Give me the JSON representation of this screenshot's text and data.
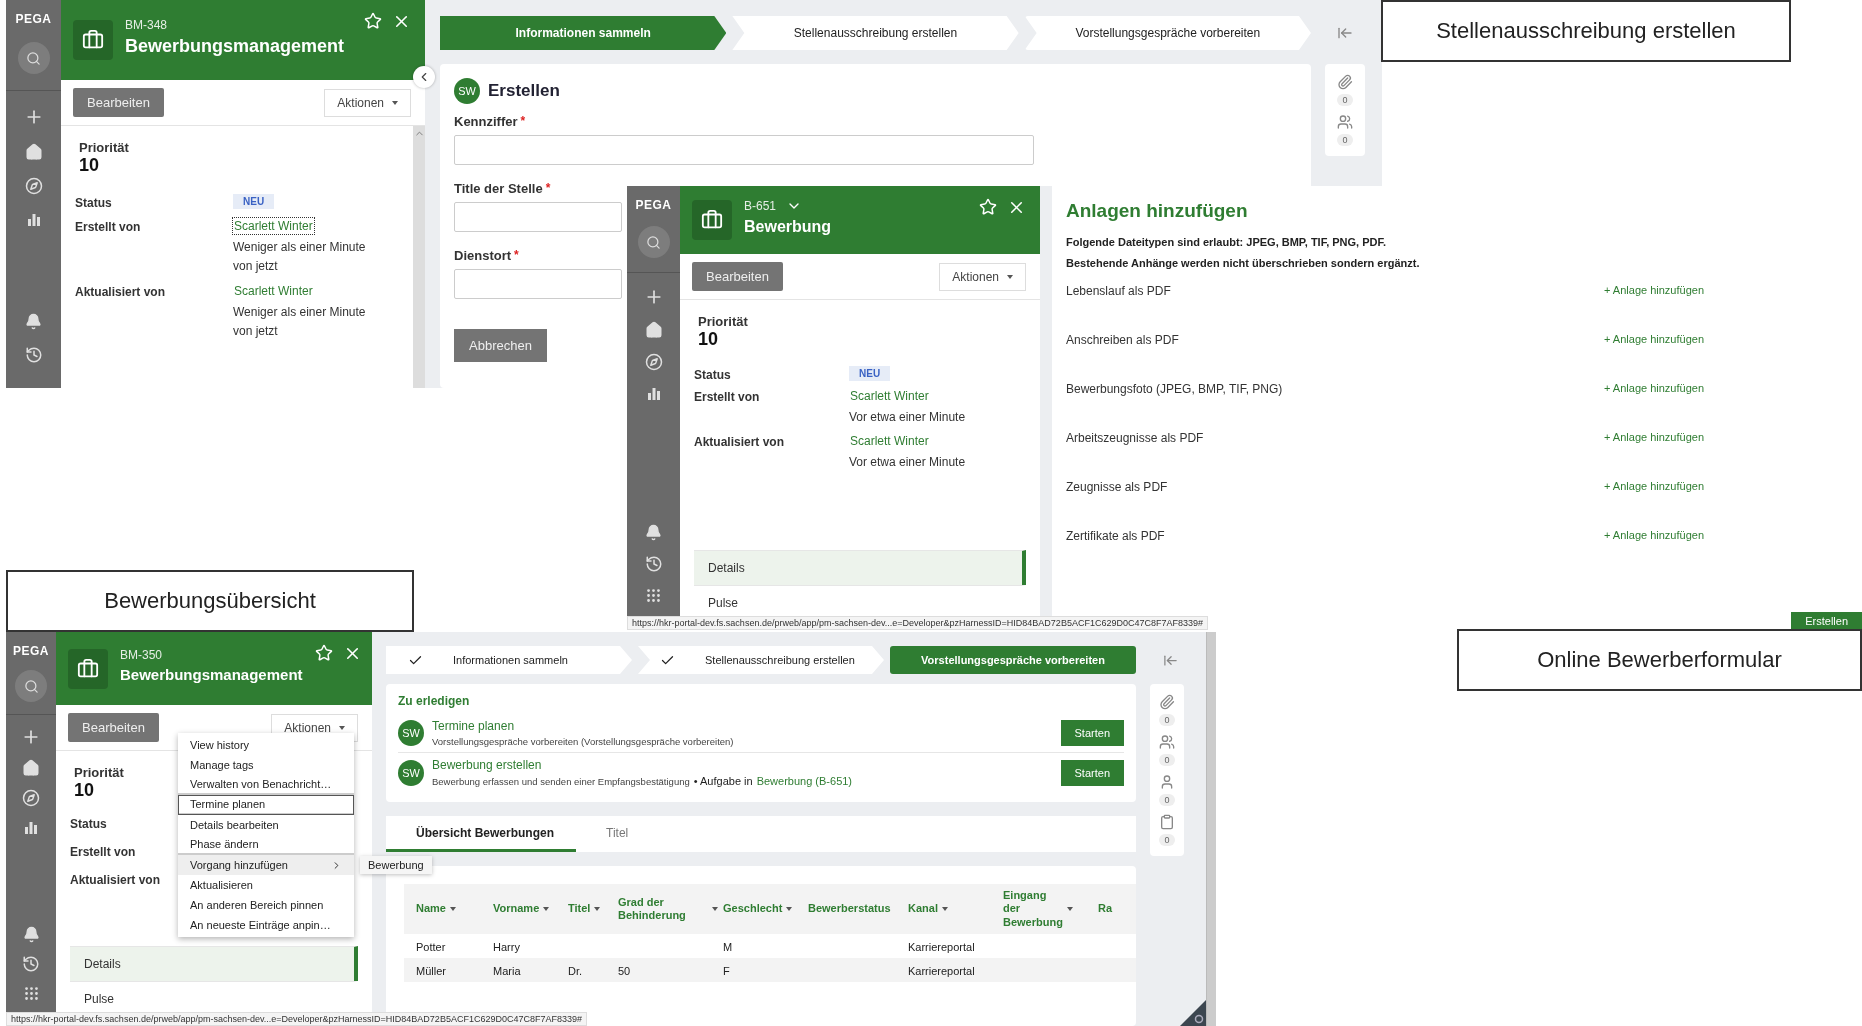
{
  "captions": [
    {
      "text": "Stellenausschreibung erstellen"
    },
    {
      "text": "Bewerbungsübersicht"
    },
    {
      "text": "Online Bewerberformular"
    }
  ],
  "screens": [
    {
      "kind": "form",
      "case": {
        "brand": "PEGA",
        "id": "BM-348",
        "id_menu": false,
        "title": "Bewerbungsmanagement",
        "edit": "Bearbeiten",
        "actions": "Aktionen",
        "priority_label": "Priorität",
        "priority": "10",
        "apps_button": false,
        "fields": [
          {
            "label": "Status",
            "badge": "NEU"
          },
          {
            "label": "Erstellt von",
            "person": "Scarlett Winter",
            "focused": true,
            "time": "Weniger als einer Minute von jetzt"
          },
          {
            "label": "Aktualisiert von",
            "person": "Scarlett Winter",
            "focused": false,
            "time": "Weniger als einer Minute von jetzt"
          }
        ]
      },
      "stages": [
        {
          "label": "Informationen sammeln",
          "selected": true,
          "done": false
        },
        {
          "label": "Stellenausschreibung erstellen",
          "selected": false,
          "done": false
        },
        {
          "label": "Vorstellungsgespräche vorbereiten",
          "selected": false,
          "done": false
        }
      ],
      "form": {
        "avatar": "SW",
        "title": "Erstellen",
        "required_mark": "*",
        "fields": [
          {
            "label": "Kennziffer",
            "required": true
          },
          {
            "label": "Title der Stelle",
            "required": true
          },
          {
            "label": "Dienstort",
            "required": true
          }
        ],
        "cancel": "Abbrechen"
      },
      "rail": [
        {
          "kind": "attachments",
          "count": "0"
        },
        {
          "kind": "followers",
          "count": "0"
        }
      ]
    },
    {
      "kind": "attachments",
      "case": {
        "brand": "PEGA",
        "id": "B-651",
        "id_menu": true,
        "title": "Bewerbung",
        "edit": "Bearbeiten",
        "actions": "Aktionen",
        "priority_label": "Priorität",
        "priority": "10",
        "apps_button": true,
        "fields": [
          {
            "label": "Status",
            "badge": "NEU"
          },
          {
            "label": "Erstellt von",
            "person": "Scarlett Winter",
            "focused": false,
            "time": "Vor etwa einer Minute"
          },
          {
            "label": "Aktualisiert von",
            "person": "Scarlett Winter",
            "focused": false,
            "time": "Vor etwa einer Minute"
          }
        ],
        "tabs": [
          {
            "label": "Details",
            "selected": true
          },
          {
            "label": "Pulse",
            "selected": false
          }
        ]
      },
      "heading": "Anlagen hinzufügen",
      "notes": [
        "Folgende Dateitypen sind erlaubt: JPEG, BMP, TIF, PNG, PDF.",
        "Bestehende Anhänge werden nicht überschrieben sondern ergänzt."
      ],
      "attachments": [
        {
          "label": "Lebenslauf als PDF",
          "action": "+ Anlage hinzufügen"
        },
        {
          "label": "Anschreiben als PDF",
          "action": "+ Anlage hinzufügen"
        },
        {
          "label": "Bewerbungsfoto (JPEG, BMP, TIF, PNG)",
          "action": "+ Anlage hinzufügen"
        },
        {
          "label": "Arbeitszeugnisse als PDF",
          "action": "+ Anlage hinzufügen"
        },
        {
          "label": "Zeugnisse als PDF",
          "action": "+ Anlage hinzufügen"
        },
        {
          "label": "Zertifikate als PDF",
          "action": "+ Anlage hinzufügen"
        }
      ],
      "submit": "Erstellen",
      "status_url": "https://hkr-portal-dev.fs.sachsen.de/prweb/app/pm-sachsen-dev...e=Developer&pzHarnessID=HID84BAD72B5ACF1C629D0C47C8F7AF8339#"
    },
    {
      "kind": "overview",
      "case": {
        "brand": "PEGA",
        "id": "BM-350",
        "id_menu": false,
        "title": "Bewerbungsmanagement",
        "edit": "Bearbeiten",
        "actions": "Aktionen",
        "priority_label": "Priorität",
        "priority": "10",
        "apps_button": true,
        "fields": [
          {
            "label": "Status"
          },
          {
            "label": "Erstellt von"
          },
          {
            "label": "Aktualisiert von"
          }
        ],
        "tabs": [
          {
            "label": "Details",
            "selected": true
          },
          {
            "label": "Pulse",
            "selected": false
          }
        ]
      },
      "menu": [
        {
          "label": "View history",
          "focused": false,
          "hovered": false,
          "submenu": false,
          "divider": false
        },
        {
          "label": "Manage tags",
          "focused": false,
          "hovered": false,
          "submenu": false,
          "divider": false
        },
        {
          "label": "Verwalten von Benachricht…",
          "focused": false,
          "hovered": false,
          "submenu": false,
          "divider": true
        },
        {
          "label": "Termine planen",
          "focused": true,
          "hovered": false,
          "submenu": false,
          "divider": true
        },
        {
          "label": "Details bearbeiten",
          "focused": false,
          "hovered": false,
          "submenu": false,
          "divider": false
        },
        {
          "label": "Phase ändern",
          "focused": false,
          "hovered": false,
          "submenu": false,
          "divider": true
        },
        {
          "label": "Vorgang hinzufügen",
          "focused": false,
          "hovered": true,
          "submenu": true,
          "divider": false
        },
        {
          "label": "Aktualisieren",
          "focused": false,
          "hovered": false,
          "submenu": false,
          "divider": false
        },
        {
          "label": "An anderen Bereich pinnen",
          "focused": false,
          "hovered": false,
          "submenu": false,
          "divider": false
        },
        {
          "label": "An neueste Einträge anpin…",
          "focused": false,
          "hovered": false,
          "submenu": false,
          "divider": false
        }
      ],
      "submenu": [
        "Bewerbung"
      ],
      "stages": [
        {
          "label": "Informationen sammeln",
          "selected": false,
          "done": true
        },
        {
          "label": "Stellenausschreibung erstellen",
          "selected": false,
          "done": true
        },
        {
          "label": "Vorstellungsgespräche vorbereiten",
          "selected": true,
          "done": false
        }
      ],
      "todo": {
        "heading": "Zu erledigen",
        "items": [
          {
            "avatar": "SW",
            "title": "Termine planen",
            "description": "Vorstellungsgespräche vorbereiten (Vorstellungsgespräche vorbereiten)",
            "button": "Starten"
          },
          {
            "avatar": "SW",
            "title": "Bewerbung erstellen",
            "description": "Bewerbung erfassen und senden einer Empfangsbestätigung",
            "context": "• Aufgabe in",
            "link": "Bewerbung (B-651)",
            "button": "Starten"
          }
        ]
      },
      "tabs": [
        {
          "label": "Übersicht Bewerbungen",
          "selected": true
        },
        {
          "label": "Titel",
          "selected": false
        }
      ],
      "table": {
        "columns": [
          {
            "label": "Name",
            "sortable": true
          },
          {
            "label": "Vorname",
            "sortable": true
          },
          {
            "label": "Titel",
            "sortable": true
          },
          {
            "label": "Grad der Behinderung",
            "sortable": true
          },
          {
            "label": "Geschlecht",
            "sortable": true
          },
          {
            "label": "Bewerberstatus",
            "sortable": false
          },
          {
            "label": "Kanal",
            "sortable": true
          },
          {
            "label": "Eingang der Bewerbung",
            "sortable": true
          },
          {
            "label": "Ra",
            "sortable": false
          }
        ],
        "rows": [
          [
            "Potter",
            "Harry",
            null,
            null,
            "M",
            null,
            "Karriereportal",
            null,
            null
          ],
          [
            "Müller",
            "Maria",
            "Dr.",
            "50",
            "F",
            null,
            "Karriereportal",
            null,
            null
          ]
        ]
      },
      "rail": [
        {
          "kind": "attachments",
          "count": "0"
        },
        {
          "kind": "followers",
          "count": "0"
        },
        {
          "kind": "stakeholders",
          "count": "0"
        },
        {
          "kind": "documents",
          "count": "0"
        }
      ],
      "status_url": "https://hkr-portal-dev.fs.sachsen.de/prweb/app/pm-sachsen-dev...e=Developer&pzHarnessID=HID84BAD72B5ACF1C629D0C47C8F7AF8339#"
    }
  ]
}
